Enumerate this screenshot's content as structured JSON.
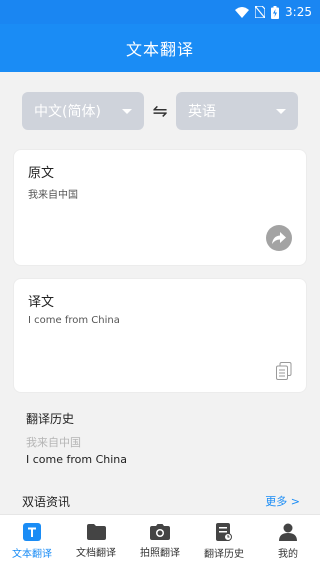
{
  "status_bar": {
    "time": "3:25"
  },
  "app_bar": {
    "title": "文本翻译"
  },
  "languages": {
    "source": "中文(简体)",
    "swap_symbol": "⇋",
    "target": "英语"
  },
  "source_card": {
    "title": "原文",
    "text": "我来自中国"
  },
  "target_card": {
    "title": "译文",
    "text": "I come from China"
  },
  "history": {
    "title": "翻译历史",
    "source": "我来自中国",
    "target": "I come from China"
  },
  "news": {
    "title": "双语资讯",
    "more": "更多 >"
  },
  "tabs": [
    {
      "label": "文本翻译",
      "icon": "text-translate-icon",
      "active": true
    },
    {
      "label": "文档翻译",
      "icon": "folder-icon",
      "active": false
    },
    {
      "label": "拍照翻译",
      "icon": "camera-icon",
      "active": false
    },
    {
      "label": "翻译历史",
      "icon": "history-doc-icon",
      "active": false
    },
    {
      "label": "我的",
      "icon": "person-icon",
      "active": false
    }
  ],
  "colors": {
    "primary": "#1a8cf5",
    "select_bg": "#cfd3db",
    "muted_text": "#b5b5b5"
  }
}
